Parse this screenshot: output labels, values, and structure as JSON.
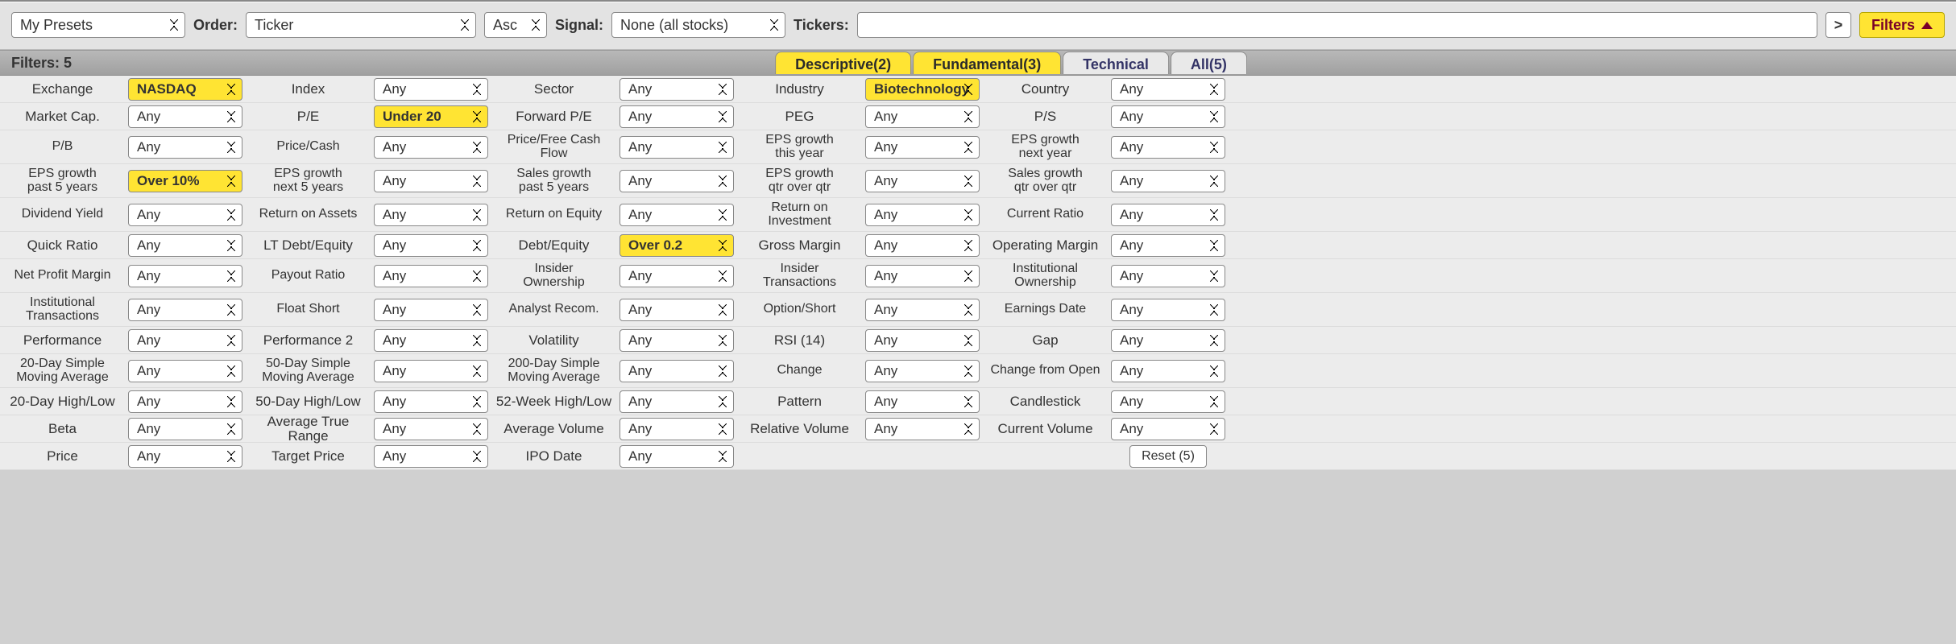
{
  "topbar": {
    "presets": "My Presets",
    "order_label": "Order:",
    "order_value": "Ticker",
    "asc_value": "Asc",
    "signal_label": "Signal:",
    "signal_value": "None (all stocks)",
    "tickers_label": "Tickers:",
    "tickers_value": "",
    "go_btn": ">",
    "filters_btn": "Filters"
  },
  "tabbar": {
    "filters_label": "Filters:",
    "filters_count": "5",
    "tabs": [
      {
        "label": "Descriptive(2)",
        "style": "active-yellow"
      },
      {
        "label": "Fundamental(3)",
        "style": "active-yellow"
      },
      {
        "label": "Technical",
        "style": ""
      },
      {
        "label": "All(5)",
        "style": ""
      }
    ]
  },
  "filters": [
    [
      {
        "label": "Exchange",
        "value": "NASDAQ",
        "highlight": true
      },
      {
        "label": "Index",
        "value": "Any",
        "highlight": false
      },
      {
        "label": "Sector",
        "value": "Any",
        "highlight": false
      },
      {
        "label": "Industry",
        "value": "Biotechnology",
        "highlight": true
      },
      {
        "label": "Country",
        "value": "Any",
        "highlight": false
      }
    ],
    [
      {
        "label": "Market Cap.",
        "value": "Any",
        "highlight": false
      },
      {
        "label": "P/E",
        "value": "Under 20",
        "highlight": true
      },
      {
        "label": "Forward P/E",
        "value": "Any",
        "highlight": false
      },
      {
        "label": "PEG",
        "value": "Any",
        "highlight": false
      },
      {
        "label": "P/S",
        "value": "Any",
        "highlight": false
      }
    ],
    [
      {
        "label": "P/B",
        "value": "Any",
        "highlight": false
      },
      {
        "label": "Price/Cash",
        "value": "Any",
        "highlight": false
      },
      {
        "label": "Price/Free Cash Flow",
        "value": "Any",
        "highlight": false
      },
      {
        "label": "EPS growth\nthis year",
        "value": "Any",
        "highlight": false
      },
      {
        "label": "EPS growth\nnext year",
        "value": "Any",
        "highlight": false
      }
    ],
    [
      {
        "label": "EPS growth\npast 5 years",
        "value": "Over 10%",
        "highlight": true
      },
      {
        "label": "EPS growth\nnext 5 years",
        "value": "Any",
        "highlight": false
      },
      {
        "label": "Sales growth\npast 5 years",
        "value": "Any",
        "highlight": false
      },
      {
        "label": "EPS growth\nqtr over qtr",
        "value": "Any",
        "highlight": false
      },
      {
        "label": "Sales growth\nqtr over qtr",
        "value": "Any",
        "highlight": false
      }
    ],
    [
      {
        "label": "Dividend Yield",
        "value": "Any",
        "highlight": false
      },
      {
        "label": "Return on Assets",
        "value": "Any",
        "highlight": false
      },
      {
        "label": "Return on Equity",
        "value": "Any",
        "highlight": false
      },
      {
        "label": "Return on\nInvestment",
        "value": "Any",
        "highlight": false
      },
      {
        "label": "Current Ratio",
        "value": "Any",
        "highlight": false
      }
    ],
    [
      {
        "label": "Quick Ratio",
        "value": "Any",
        "highlight": false
      },
      {
        "label": "LT Debt/Equity",
        "value": "Any",
        "highlight": false
      },
      {
        "label": "Debt/Equity",
        "value": "Over 0.2",
        "highlight": true
      },
      {
        "label": "Gross Margin",
        "value": "Any",
        "highlight": false
      },
      {
        "label": "Operating Margin",
        "value": "Any",
        "highlight": false
      }
    ],
    [
      {
        "label": "Net Profit Margin",
        "value": "Any",
        "highlight": false
      },
      {
        "label": "Payout Ratio",
        "value": "Any",
        "highlight": false
      },
      {
        "label": "Insider\nOwnership",
        "value": "Any",
        "highlight": false
      },
      {
        "label": "Insider\nTransactions",
        "value": "Any",
        "highlight": false
      },
      {
        "label": "Institutional\nOwnership",
        "value": "Any",
        "highlight": false
      }
    ],
    [
      {
        "label": "Institutional\nTransactions",
        "value": "Any",
        "highlight": false
      },
      {
        "label": "Float Short",
        "value": "Any",
        "highlight": false
      },
      {
        "label": "Analyst Recom.",
        "value": "Any",
        "highlight": false
      },
      {
        "label": "Option/Short",
        "value": "Any",
        "highlight": false
      },
      {
        "label": "Earnings Date",
        "value": "Any",
        "highlight": false
      }
    ],
    [
      {
        "label": "Performance",
        "value": "Any",
        "highlight": false
      },
      {
        "label": "Performance 2",
        "value": "Any",
        "highlight": false
      },
      {
        "label": "Volatility",
        "value": "Any",
        "highlight": false
      },
      {
        "label": "RSI (14)",
        "value": "Any",
        "highlight": false
      },
      {
        "label": "Gap",
        "value": "Any",
        "highlight": false
      }
    ],
    [
      {
        "label": "20-Day Simple\nMoving Average",
        "value": "Any",
        "highlight": false
      },
      {
        "label": "50-Day Simple\nMoving Average",
        "value": "Any",
        "highlight": false
      },
      {
        "label": "200-Day Simple\nMoving Average",
        "value": "Any",
        "highlight": false
      },
      {
        "label": "Change",
        "value": "Any",
        "highlight": false
      },
      {
        "label": "Change from Open",
        "value": "Any",
        "highlight": false
      }
    ],
    [
      {
        "label": "20-Day High/Low",
        "value": "Any",
        "highlight": false
      },
      {
        "label": "50-Day High/Low",
        "value": "Any",
        "highlight": false
      },
      {
        "label": "52-Week High/Low",
        "value": "Any",
        "highlight": false
      },
      {
        "label": "Pattern",
        "value": "Any",
        "highlight": false
      },
      {
        "label": "Candlestick",
        "value": "Any",
        "highlight": false
      }
    ],
    [
      {
        "label": "Beta",
        "value": "Any",
        "highlight": false
      },
      {
        "label": "Average True Range",
        "value": "Any",
        "highlight": false
      },
      {
        "label": "Average Volume",
        "value": "Any",
        "highlight": false
      },
      {
        "label": "Relative Volume",
        "value": "Any",
        "highlight": false
      },
      {
        "label": "Current Volume",
        "value": "Any",
        "highlight": false
      }
    ],
    [
      {
        "label": "Price",
        "value": "Any",
        "highlight": false
      },
      {
        "label": "Target Price",
        "value": "Any",
        "highlight": false
      },
      {
        "label": "IPO Date",
        "value": "Any",
        "highlight": false
      },
      {
        "label": "",
        "value": "",
        "empty": true
      },
      {
        "label": "",
        "value": "",
        "reset": true
      }
    ]
  ],
  "reset_label": "Reset (5)",
  "tall_rows": [
    2,
    3,
    4,
    6,
    7,
    9
  ]
}
